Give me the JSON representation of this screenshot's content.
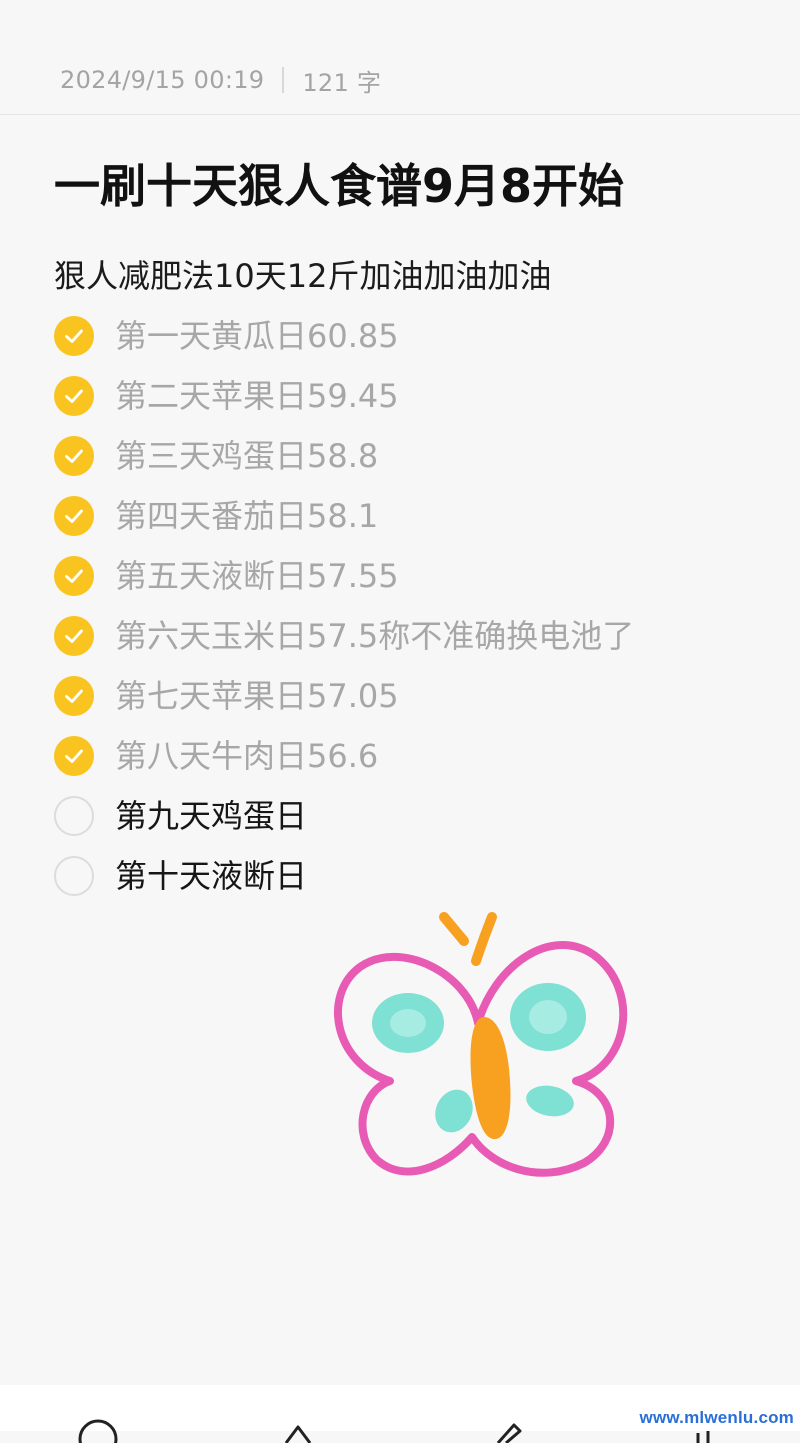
{
  "note": {
    "date": "2024/9/15 00:19",
    "word_count": "121 字",
    "title": "一刷十天狠人食谱9月8开始",
    "subtitle": "狠人减肥法10天12斤加油加油加油",
    "items": [
      {
        "text": "第一天黄瓜日60.85",
        "checked": true
      },
      {
        "text": "第二天苹果日59.45",
        "checked": true
      },
      {
        "text": "第三天鸡蛋日58.8",
        "checked": true
      },
      {
        "text": "第四天番茄日58.1",
        "checked": true
      },
      {
        "text": "第五天液断日57.55",
        "checked": true
      },
      {
        "text": "第六天玉米日57.5称不准确换电池了",
        "checked": true
      },
      {
        "text": "第七天苹果日57.05",
        "checked": true
      },
      {
        "text": "第八天牛肉日56.6",
        "checked": true
      },
      {
        "text": "第九天鸡蛋日",
        "checked": false
      },
      {
        "text": "第十天液断日",
        "checked": false
      }
    ]
  },
  "colors": {
    "check_done": "#f9c41f",
    "text_done": "#a7a7a7",
    "text_todo": "#161616",
    "butterfly_outline": "#e85bb5",
    "butterfly_wings": "#7fe0d4",
    "butterfly_body": "#f8a020"
  },
  "icons": {
    "checked": "check-circle-icon",
    "unchecked": "empty-circle-icon",
    "sticker": "butterfly-sticker",
    "toolbar": [
      "checklist-icon",
      "bookmark-icon",
      "pen-icon",
      "more-icon"
    ]
  },
  "watermark": "www.mlwenlu.com"
}
